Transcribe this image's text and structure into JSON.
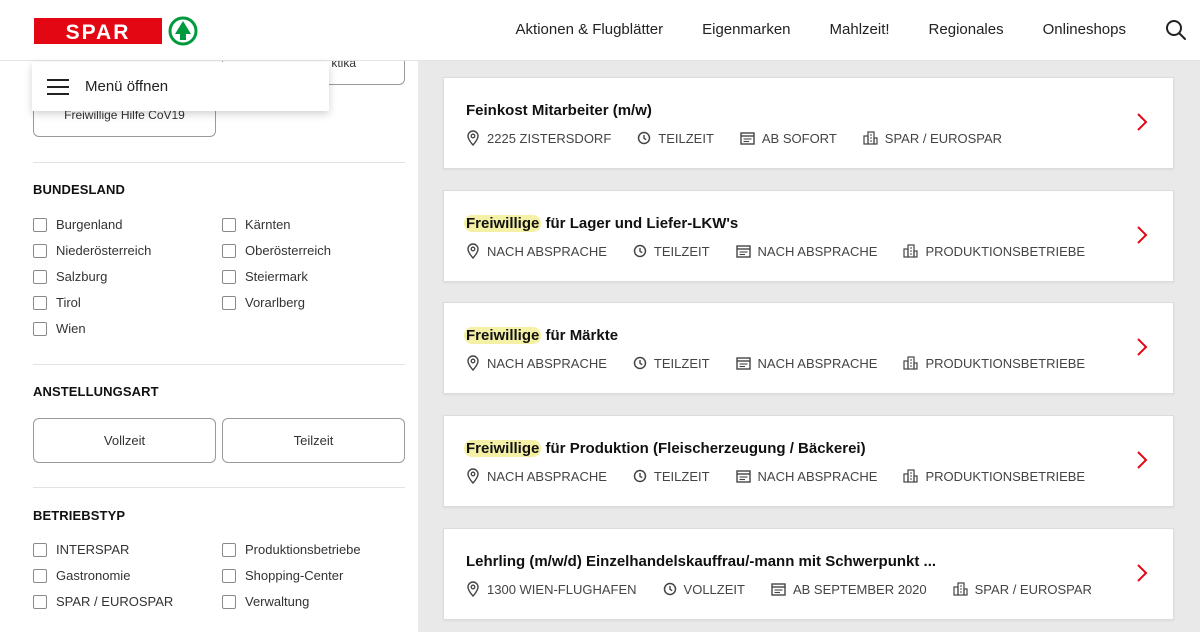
{
  "brand": {
    "name": "SPAR",
    "accent": "#e30613",
    "green": "#009a3e"
  },
  "nav": {
    "items": [
      "Aktionen & Flugblätter",
      "Eigenmarken",
      "Mahlzeit!",
      "Regionales",
      "Onlineshops"
    ],
    "search_icon": "search-icon"
  },
  "sidebar": {
    "menu_label": "Menü öffnen",
    "partial_pill": "ktika",
    "cov_pill": "Freiwillige Hilfe CoV19",
    "bundesland": {
      "title": "BUNDESLAND",
      "options": [
        "Burgenland",
        "Kärnten",
        "Niederösterreich",
        "Oberösterreich",
        "Salzburg",
        "Steiermark",
        "Tirol",
        "Vorarlberg",
        "Wien"
      ]
    },
    "anstellungsart": {
      "title": "ANSTELLUNGSART",
      "buttons": [
        "Vollzeit",
        "Teilzeit"
      ]
    },
    "betriebstyp": {
      "title": "BETRIEBSTYP",
      "options": [
        "INTERSPAR",
        "Produktionsbetriebe",
        "Gastronomie",
        "Shopping-Center",
        "SPAR / EUROSPAR",
        "Verwaltung"
      ]
    }
  },
  "jobs": [
    {
      "highlight": "",
      "title": "Feinkost Mitarbeiter (m/w)",
      "location": "2225 ZISTERSDORF",
      "type": "TEILZEIT",
      "start": "AB SOFORT",
      "company": "SPAR / EUROSPAR"
    },
    {
      "highlight": "Freiwillige",
      "title": " für Lager und Liefer-LKW's",
      "location": "NACH ABSPRACHE",
      "type": "TEILZEIT",
      "start": "NACH ABSPRACHE",
      "company": "PRODUKTIONSBETRIEBE"
    },
    {
      "highlight": "Freiwillige",
      "title": " für Märkte",
      "location": "NACH ABSPRACHE",
      "type": "TEILZEIT",
      "start": "NACH ABSPRACHE",
      "company": "PRODUKTIONSBETRIEBE"
    },
    {
      "highlight": "Freiwillige",
      "title": " für Produktion (Fleischerzeugung / Bäckerei)",
      "location": "NACH ABSPRACHE",
      "type": "TEILZEIT",
      "start": "NACH ABSPRACHE",
      "company": "PRODUKTIONSBETRIEBE"
    },
    {
      "highlight": "",
      "title": "Lehrling (m/w/d) Einzelhandelskauffrau/-mann mit Schwerpunkt ...",
      "location": "1300 WIEN-FLUGHAFEN",
      "type": "VOLLZEIT",
      "start": "AB SEPTEMBER 2020",
      "company": "SPAR / EUROSPAR"
    }
  ]
}
